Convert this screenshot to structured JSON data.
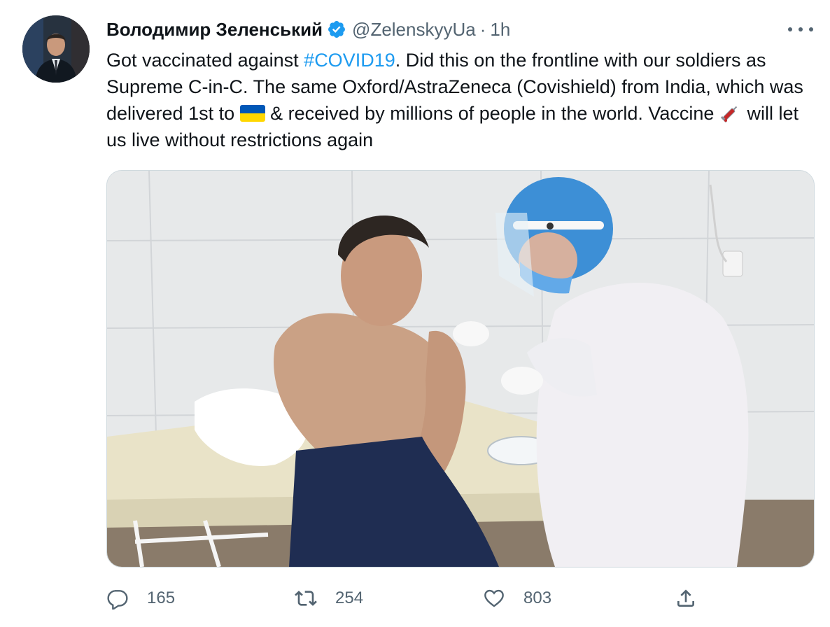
{
  "tweet": {
    "author_name": "Володимир Зеленський",
    "handle": "@ZelenskyyUa",
    "separator": "·",
    "time": "1h",
    "text": {
      "part1": "Got vaccinated against ",
      "hashtag": "#COVID19",
      "part2": ". Did this on the frontline with our soldiers as Supreme C-in-C. The same Oxford/AstraZeneca (Covishield) from India, which was delivered 1st to ",
      "part3": " & received by millions of people in the world. Vaccine ",
      "part4": " will let us live without restrictions again"
    },
    "emojis": {
      "flag": "ukraine-flag-icon",
      "syringe": "syringe-icon"
    }
  },
  "actions": {
    "reply_count": "165",
    "retweet_count": "254",
    "like_count": "803"
  },
  "colors": {
    "link": "#1d9bf0",
    "secondary_text": "#536471",
    "verified": "#1d9bf0"
  }
}
